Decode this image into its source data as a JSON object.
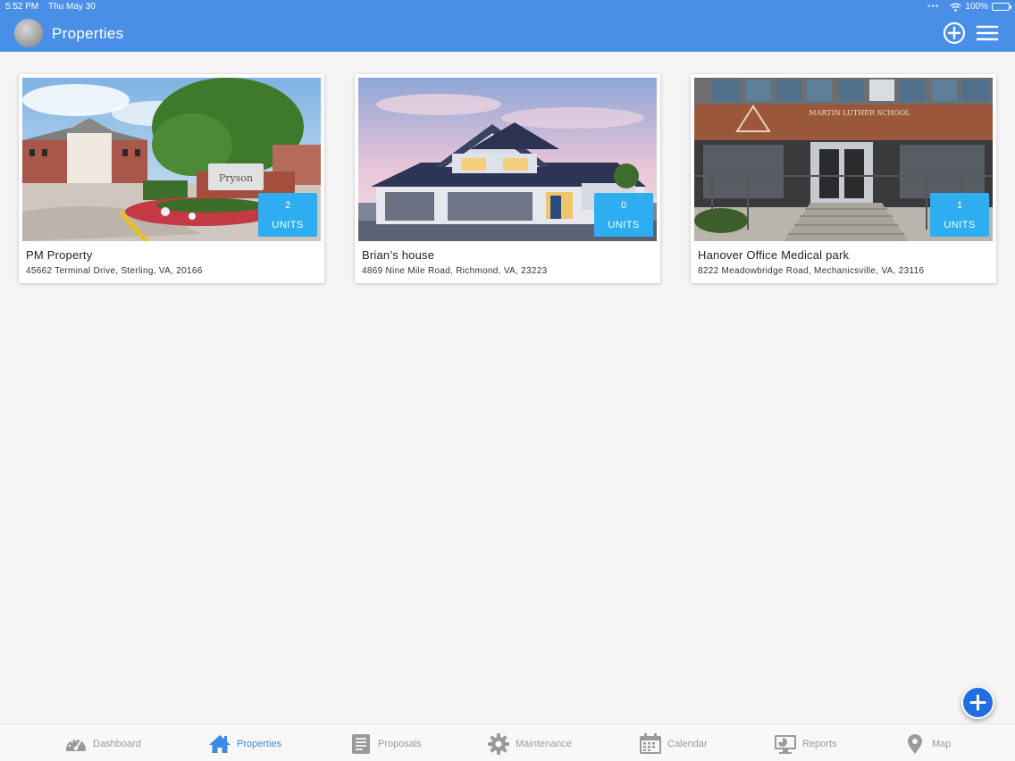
{
  "status_bar": {
    "time": "5:52 PM",
    "date": "Thu May 30",
    "battery": "100%"
  },
  "header": {
    "title": "Properties"
  },
  "properties": [
    {
      "name": "PM Property",
      "address": "45662 Terminal Drive, Sterling, VA, 20166",
      "units_count": "2",
      "units_label": "UNITS",
      "sign_text": "Pryson"
    },
    {
      "name": "Brian’s house",
      "address": "4869 Nine Mile Road, Richmond, VA, 23223",
      "units_count": "0",
      "units_label": "UNITS"
    },
    {
      "name": "Hanover Office Medical park",
      "address": "8222 Meadowbridge Road, Mechanicsville, VA, 23116",
      "units_count": "1",
      "units_label": "UNITS",
      "sign_text": "MARTIN LUTHER SCHOOL"
    }
  ],
  "tabs": [
    {
      "label": "Dashboard",
      "icon": "gauge-icon",
      "active": false
    },
    {
      "label": "Properties",
      "icon": "home-icon",
      "active": true
    },
    {
      "label": "Proposals",
      "icon": "document-icon",
      "active": false
    },
    {
      "label": "Maintenance",
      "icon": "gear-icon",
      "active": false
    },
    {
      "label": "Calendar",
      "icon": "calendar-icon",
      "active": false
    },
    {
      "label": "Reports",
      "icon": "monitor-chart-icon",
      "active": false
    },
    {
      "label": "Map",
      "icon": "map-pin-icon",
      "active": false
    }
  ],
  "colors": {
    "header": "#4a8fe7",
    "badge": "#2eaef0",
    "fab": "#1f6fe0",
    "active_tab": "#3b8ae6",
    "inactive_tab": "#9a9a9a"
  }
}
